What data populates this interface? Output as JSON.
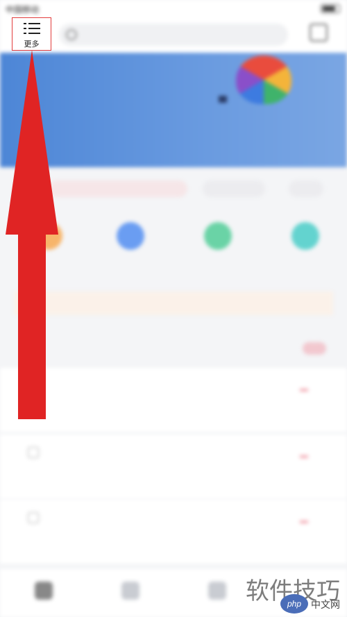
{
  "status_bar": {
    "carrier": "中国移动",
    "time": ""
  },
  "search": {
    "chips": [
      "",
      "",
      ""
    ]
  },
  "menu": {
    "label": "更多"
  },
  "watermark": {
    "text": "软件技巧",
    "badge": "php",
    "site": "中文网"
  },
  "colors": {
    "arrow": "#e02424",
    "hero": "#5b91dc",
    "highlight_box": "#e23b3b"
  },
  "icons": [
    "menu-icon",
    "search-icon",
    "scan-icon"
  ]
}
